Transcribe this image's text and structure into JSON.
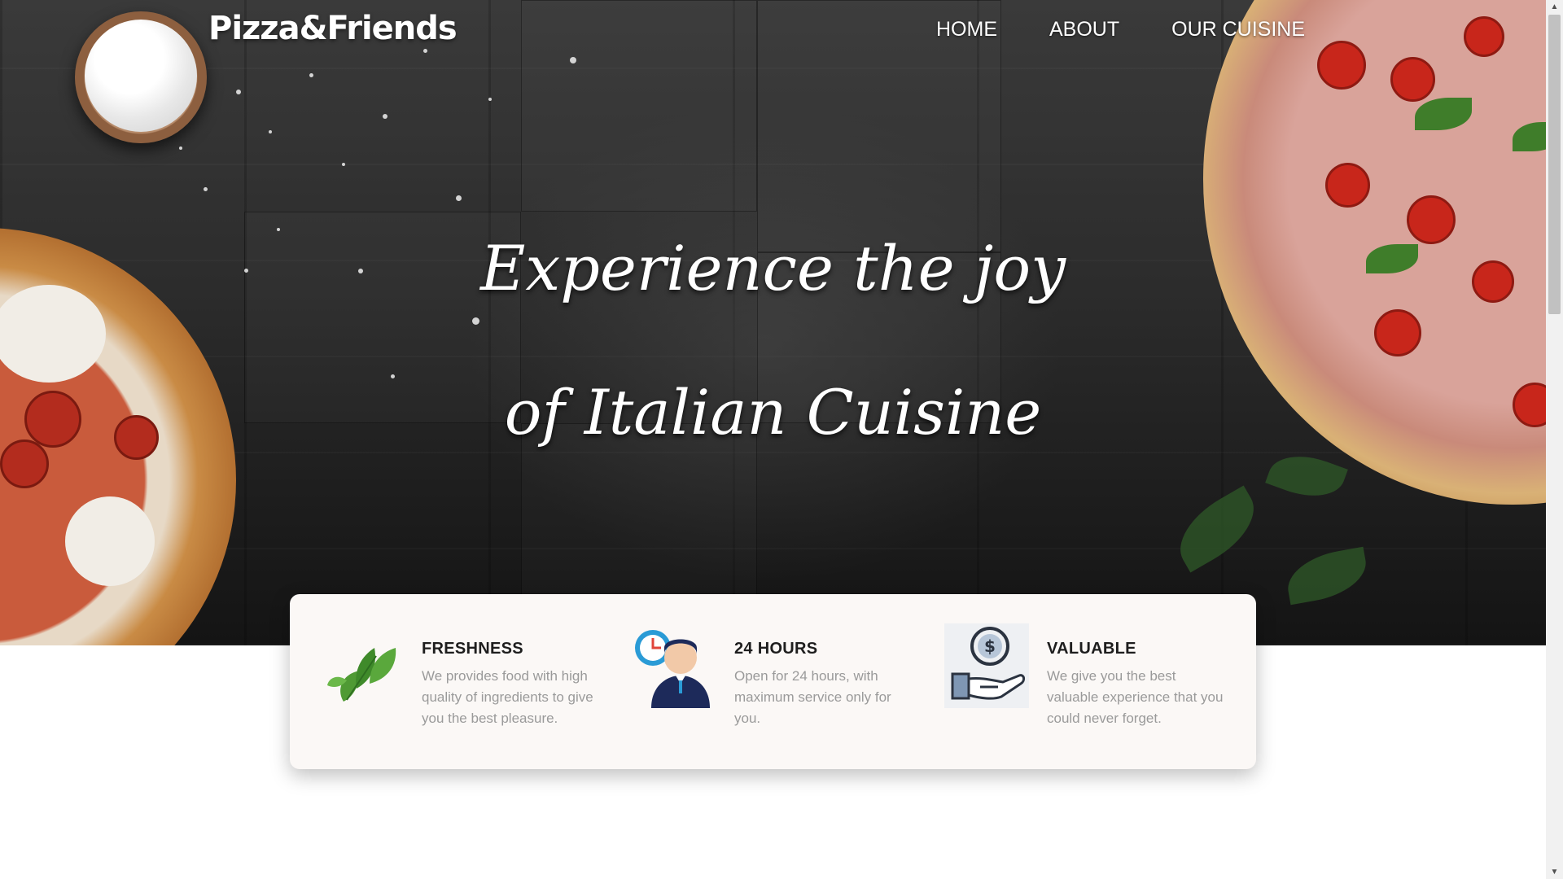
{
  "brand": {
    "logo_text": "Pizza&Friends"
  },
  "nav": {
    "items": [
      {
        "label": "HOME"
      },
      {
        "label": "ABOUT"
      },
      {
        "label": "OUR CUISINE"
      }
    ]
  },
  "hero": {
    "line1": "Experience the joy",
    "line2": "of Italian Cuisine"
  },
  "features": [
    {
      "icon": "leaves-icon",
      "title": "FRESHNESS",
      "description": "We provides food with high quality of ingredients to give you the best pleasure."
    },
    {
      "icon": "support-agent-clock-icon",
      "title": "24 HOURS",
      "description": "Open for 24 hours, with maximum service only for you."
    },
    {
      "icon": "hand-coin-icon",
      "title": "VALUABLE",
      "description": "We give you the best valuable experience that you could never forget."
    }
  ],
  "colors": {
    "hero_dark": "#2c2c2c",
    "card_bg": "#fbf8f6",
    "title_text": "#1e1e1e",
    "desc_text": "#9a9a9a"
  }
}
